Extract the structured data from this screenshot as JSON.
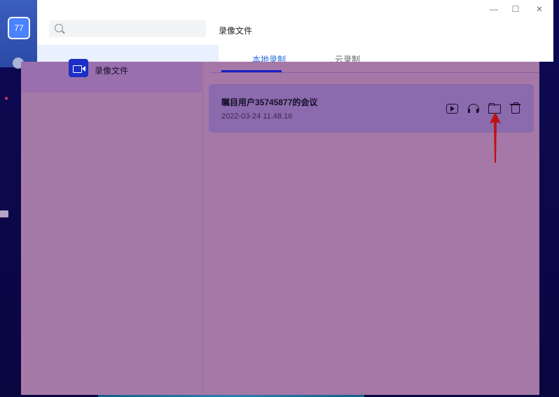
{
  "app": {
    "avatar_label": "77",
    "title": "录像文件"
  },
  "window_controls": {
    "minimize": "—",
    "maximize": "☐",
    "close": "✕"
  },
  "search": {
    "placeholder": ""
  },
  "sidebar": {
    "items": [
      {
        "label": "录像文件",
        "icon": "video-camera-icon",
        "active": true
      }
    ]
  },
  "tabs": [
    {
      "label": "本地录制",
      "active": true
    },
    {
      "label": "云录制",
      "active": false
    }
  ],
  "recordings": [
    {
      "title": "瞩目用户35745877的会议",
      "timestamp": "2022-03-24 11.48.16",
      "actions": [
        "play-icon",
        "headphone-icon",
        "open-folder-icon",
        "trash-icon"
      ]
    }
  ],
  "colors": {
    "accent": "#2b6fdf",
    "overlay": "#a578a7",
    "annotation_arrow": "#c01010"
  }
}
